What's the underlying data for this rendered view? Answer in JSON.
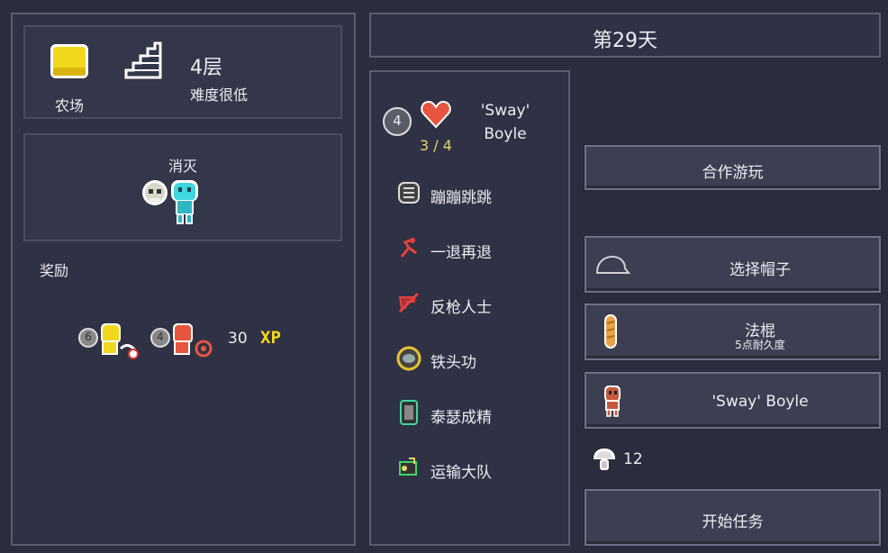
{
  "left": {
    "level_label": "农场",
    "floor": "4层",
    "difficulty": "难度很低",
    "mission_title": "消灭",
    "rewards_title": "奖励",
    "reward_1_count": "6",
    "reward_2_count": "4",
    "xp_amount": "30",
    "xp_label": "XP"
  },
  "middle": {
    "day_title": "第29天",
    "player_level": "4",
    "hp": "3 / 4",
    "player_name_line1": "'Sway'",
    "player_name_line2": "Boyle",
    "traits": [
      "蹦蹦跳跳",
      "一退再退",
      "反枪人士",
      "铁头功",
      "泰瑟成精",
      "运输大队"
    ]
  },
  "right": {
    "coop_button": "合作游玩",
    "hat_button": "选择帽子",
    "weapon_name": "法棍",
    "weapon_durability": "5点耐久度",
    "character_button": "'Sway' Boyle",
    "currency_count": "12",
    "start_button": "开始任务"
  },
  "colors": {
    "background": "#2b2d3e",
    "panel_border": "#5b5e72",
    "yellow_accent": "#e7d56a",
    "heart_red": "#e8553f",
    "cyan_enemy": "#3fd6e0"
  }
}
